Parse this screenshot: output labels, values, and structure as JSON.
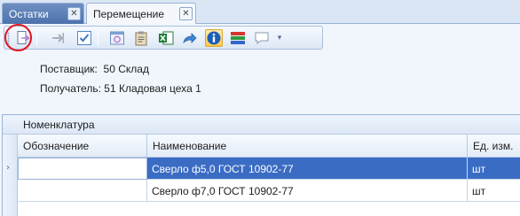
{
  "tabs": [
    {
      "label": "Остатки",
      "close": "✕"
    },
    {
      "label": "Перемещение",
      "close": "✕"
    }
  ],
  "toolbar": {
    "icons": [
      "exit-document-icon",
      "forward-arrow-icon",
      "checkmark-icon",
      "settings-dialog-icon",
      "clipboard-icon",
      "excel-icon",
      "blue-arrow-icon",
      "info-icon",
      "color-bars-icon",
      "speech-bubble-icon",
      "dropdown-arrow-icon"
    ],
    "dropdown": "▾"
  },
  "info": {
    "supplier_label": "Поставщик:",
    "supplier_value": "50 Склад",
    "receiver_label": "Получатель:",
    "receiver_value": "51 Кладовая цеха 1"
  },
  "grid": {
    "group_label": "Номенклатура",
    "columns": [
      "Обозначение",
      "Наименование",
      "Ед. изм."
    ],
    "rows": [
      {
        "indicator": "›",
        "designation": "",
        "name": "Сверло ф5,0 ГОСТ 10902-77",
        "unit": "шт"
      },
      {
        "indicator": "",
        "designation": "",
        "name": "Сверло ф7,0 ГОСТ 10902-77",
        "unit": "шт"
      }
    ]
  },
  "colors": {
    "selected_row": "#3a6cc4",
    "inactive_tab": "#5a7fb7",
    "highlight_ring": "#e0141e"
  }
}
